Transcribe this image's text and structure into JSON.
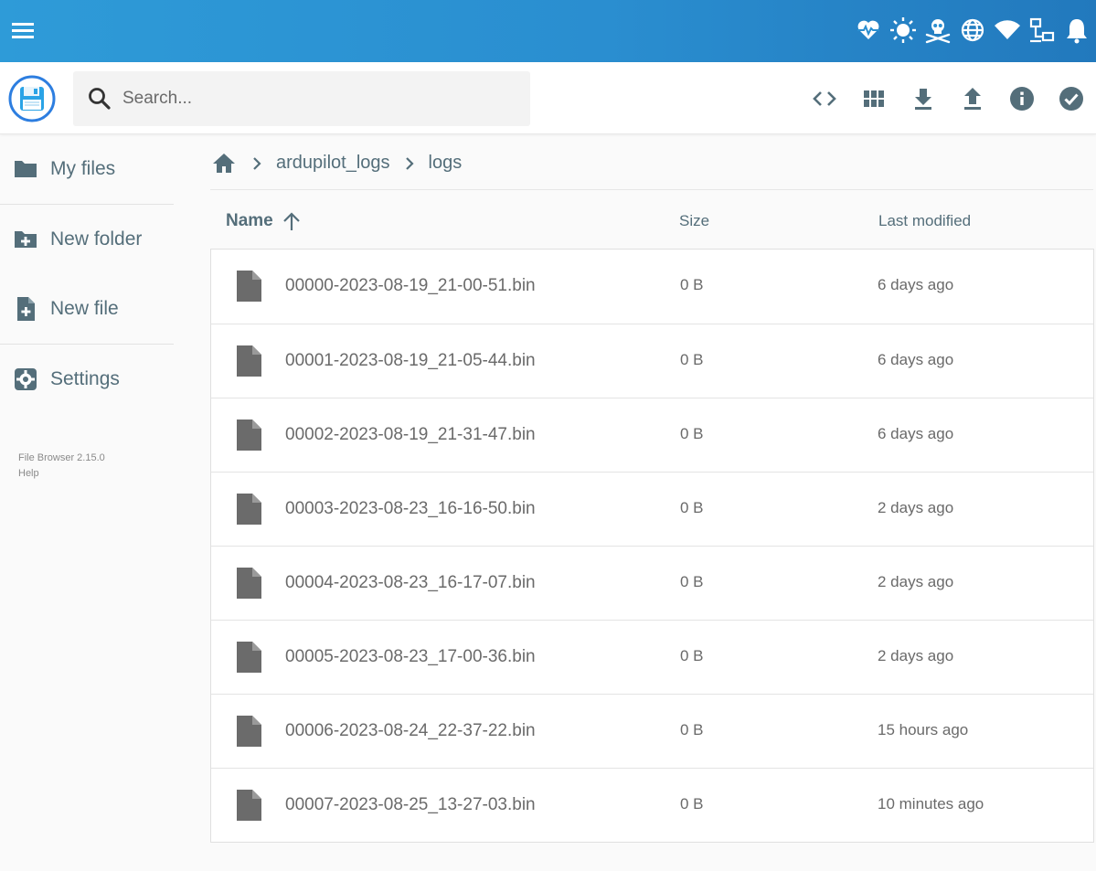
{
  "topbar": {
    "status_icons": [
      "heartbeat-icon",
      "sun-icon",
      "skull-crossbones-icon",
      "globe-icon",
      "wifi-icon",
      "network-icon",
      "bell-icon"
    ]
  },
  "header": {
    "logo": "floppy-disk-icon",
    "search": {
      "placeholder": "Search...",
      "value": ""
    },
    "actions": [
      "code-icon",
      "grid-view-icon",
      "download-icon",
      "upload-icon",
      "info-icon",
      "check-circle-icon"
    ]
  },
  "sidebar": {
    "items": [
      {
        "label": "My files",
        "icon": "folder-icon"
      },
      {
        "label": "New folder",
        "icon": "folder-plus-icon"
      },
      {
        "label": "New file",
        "icon": "file-plus-icon"
      },
      {
        "label": "Settings",
        "icon": "gear-icon"
      }
    ],
    "footer": {
      "version": "File Browser 2.15.0",
      "help": "Help"
    }
  },
  "breadcrumbs": [
    "ardupilot_logs",
    "logs"
  ],
  "list": {
    "columns": {
      "name": "Name",
      "size": "Size",
      "modified": "Last modified"
    },
    "sort": {
      "column": "name",
      "direction": "ascending"
    },
    "files": [
      {
        "name": "00000-2023-08-19_21-00-51.bin",
        "size": "0 B",
        "modified": "6 days ago"
      },
      {
        "name": "00001-2023-08-19_21-05-44.bin",
        "size": "0 B",
        "modified": "6 days ago"
      },
      {
        "name": "00002-2023-08-19_21-31-47.bin",
        "size": "0 B",
        "modified": "6 days ago"
      },
      {
        "name": "00003-2023-08-23_16-16-50.bin",
        "size": "0 B",
        "modified": "2 days ago"
      },
      {
        "name": "00004-2023-08-23_16-17-07.bin",
        "size": "0 B",
        "modified": "2 days ago"
      },
      {
        "name": "00005-2023-08-23_17-00-36.bin",
        "size": "0 B",
        "modified": "2 days ago"
      },
      {
        "name": "00006-2023-08-24_22-37-22.bin",
        "size": "0 B",
        "modified": "15 hours ago"
      },
      {
        "name": "00007-2023-08-25_13-27-03.bin",
        "size": "0 B",
        "modified": "10 minutes ago"
      }
    ]
  },
  "colors": {
    "topbar": "#2a8ed0",
    "text": "#546e7a",
    "file_icon": "#6b6b6b"
  }
}
